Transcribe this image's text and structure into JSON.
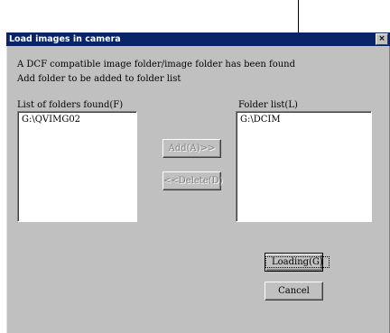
{
  "window": {
    "title": "Load images in camera",
    "close_label": "×"
  },
  "messages": {
    "line1": "A DCF compatible image folder/image folder has been found",
    "line2": "Add folder to be added to folder list"
  },
  "folders_found": {
    "label": "List of folders found(F)",
    "items": [
      "G:\\QVIMG02"
    ]
  },
  "folder_list": {
    "label": "Folder list(L)",
    "items": [
      "G:\\DCIM"
    ]
  },
  "buttons": {
    "add": "Add(A)>>",
    "delete": "<<Delete(D)",
    "loading": "Loading(G)",
    "cancel": "Cancel"
  }
}
